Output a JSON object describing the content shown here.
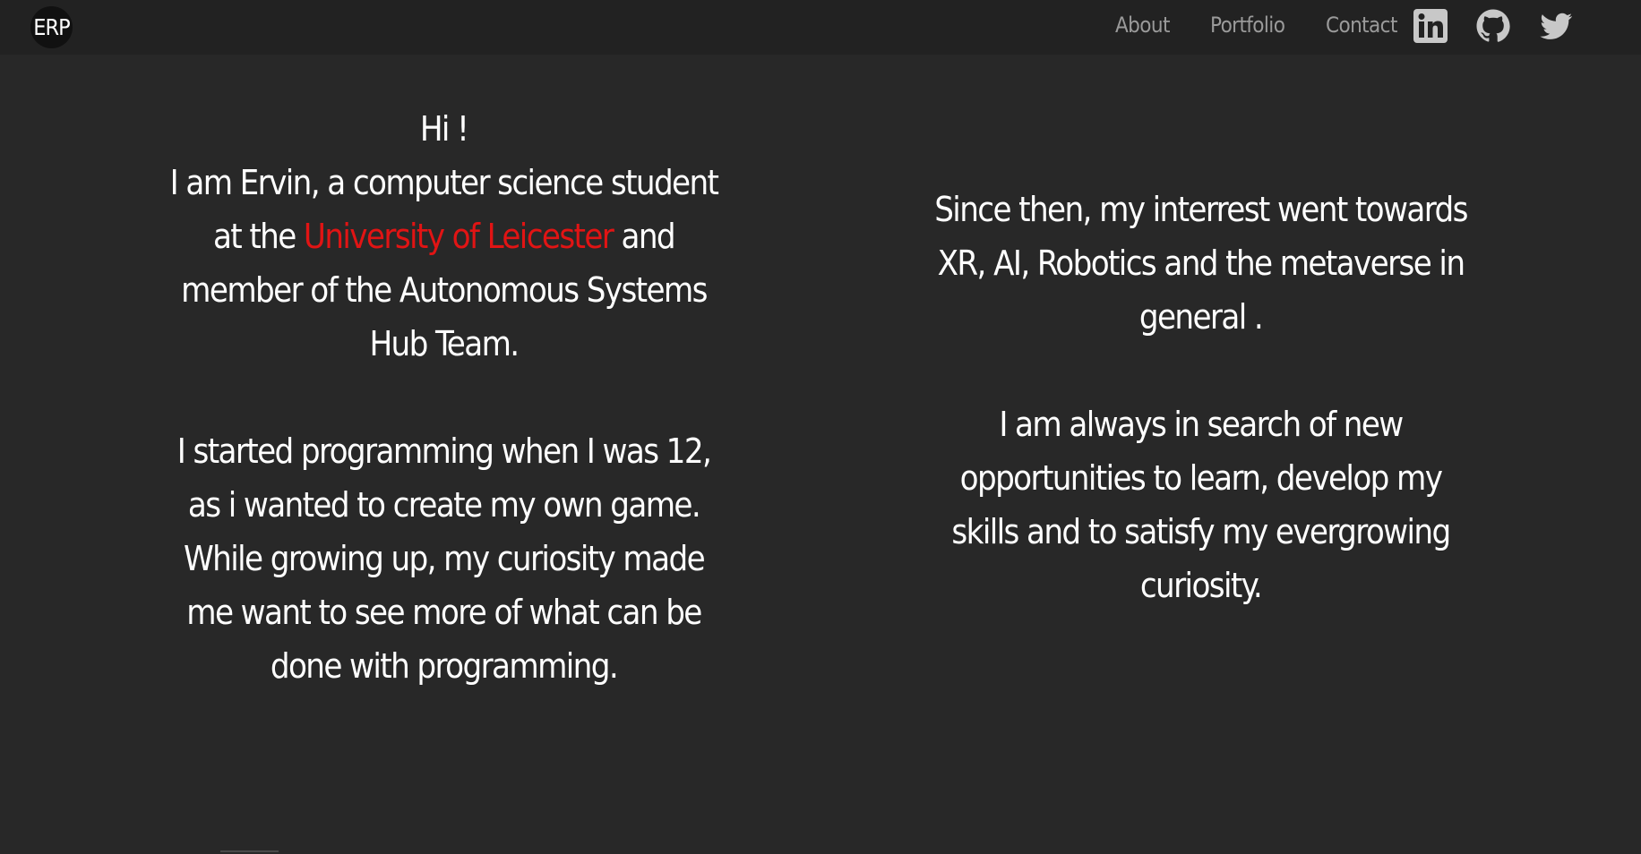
{
  "brand": {
    "logo_text": "ERP"
  },
  "nav": {
    "links": [
      {
        "label": "About"
      },
      {
        "label": "Portfolio"
      },
      {
        "label": "Contact"
      }
    ],
    "social": [
      "linkedin-icon",
      "github-icon",
      "twitter-icon"
    ]
  },
  "left": {
    "greeting": "Hi !",
    "intro_line1": "I am Ervin, a computer science student",
    "intro_line2_pre": "at the ",
    "university": "University of Leicester",
    "intro_line2_post": " and",
    "intro_line3": "member of the Autonomous Systems",
    "intro_line4": "Hub Team.",
    "story_line1": "I started programming when I was 12,",
    "story_line2": "as i wanted to create my own game.",
    "story_line3": "While growing up, my curiosity made",
    "story_line4": "me want to see more of what can be",
    "story_line5": "done with programming."
  },
  "right": {
    "interest_line1": "Since then, my interrest went towards",
    "interest_line2": "XR, AI, Robotics and the metaverse in",
    "interest_line3": "general .",
    "search_line1": "I am always in search of new",
    "search_line2": "opportunities to learn, develop my",
    "search_line3": "skills and to satisfy my evergrowing",
    "search_line4": "curiosity."
  },
  "colors": {
    "background": "#282828",
    "navbar": "#222222",
    "accent": "#e11414",
    "nav_text": "#9a9a9a"
  }
}
